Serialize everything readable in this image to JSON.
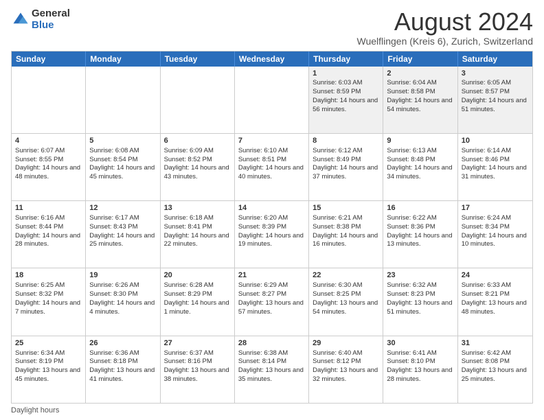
{
  "logo": {
    "general": "General",
    "blue": "Blue"
  },
  "title": "August 2024",
  "subtitle": "Wuelflingen (Kreis 6), Zurich, Switzerland",
  "days": [
    "Sunday",
    "Monday",
    "Tuesday",
    "Wednesday",
    "Thursday",
    "Friday",
    "Saturday"
  ],
  "footer": "Daylight hours",
  "weeks": [
    [
      {
        "day": "",
        "sunrise": "",
        "sunset": "",
        "daylight": "",
        "empty": true
      },
      {
        "day": "",
        "sunrise": "",
        "sunset": "",
        "daylight": "",
        "empty": true
      },
      {
        "day": "",
        "sunrise": "",
        "sunset": "",
        "daylight": "",
        "empty": true
      },
      {
        "day": "",
        "sunrise": "",
        "sunset": "",
        "daylight": "",
        "empty": true
      },
      {
        "day": "1",
        "sunrise": "Sunrise: 6:03 AM",
        "sunset": "Sunset: 8:59 PM",
        "daylight": "Daylight: 14 hours and 56 minutes.",
        "empty": false
      },
      {
        "day": "2",
        "sunrise": "Sunrise: 6:04 AM",
        "sunset": "Sunset: 8:58 PM",
        "daylight": "Daylight: 14 hours and 54 minutes.",
        "empty": false
      },
      {
        "day": "3",
        "sunrise": "Sunrise: 6:05 AM",
        "sunset": "Sunset: 8:57 PM",
        "daylight": "Daylight: 14 hours and 51 minutes.",
        "empty": false
      }
    ],
    [
      {
        "day": "4",
        "sunrise": "Sunrise: 6:07 AM",
        "sunset": "Sunset: 8:55 PM",
        "daylight": "Daylight: 14 hours and 48 minutes.",
        "empty": false
      },
      {
        "day": "5",
        "sunrise": "Sunrise: 6:08 AM",
        "sunset": "Sunset: 8:54 PM",
        "daylight": "Daylight: 14 hours and 45 minutes.",
        "empty": false
      },
      {
        "day": "6",
        "sunrise": "Sunrise: 6:09 AM",
        "sunset": "Sunset: 8:52 PM",
        "daylight": "Daylight: 14 hours and 43 minutes.",
        "empty": false
      },
      {
        "day": "7",
        "sunrise": "Sunrise: 6:10 AM",
        "sunset": "Sunset: 8:51 PM",
        "daylight": "Daylight: 14 hours and 40 minutes.",
        "empty": false
      },
      {
        "day": "8",
        "sunrise": "Sunrise: 6:12 AM",
        "sunset": "Sunset: 8:49 PM",
        "daylight": "Daylight: 14 hours and 37 minutes.",
        "empty": false
      },
      {
        "day": "9",
        "sunrise": "Sunrise: 6:13 AM",
        "sunset": "Sunset: 8:48 PM",
        "daylight": "Daylight: 14 hours and 34 minutes.",
        "empty": false
      },
      {
        "day": "10",
        "sunrise": "Sunrise: 6:14 AM",
        "sunset": "Sunset: 8:46 PM",
        "daylight": "Daylight: 14 hours and 31 minutes.",
        "empty": false
      }
    ],
    [
      {
        "day": "11",
        "sunrise": "Sunrise: 6:16 AM",
        "sunset": "Sunset: 8:44 PM",
        "daylight": "Daylight: 14 hours and 28 minutes.",
        "empty": false
      },
      {
        "day": "12",
        "sunrise": "Sunrise: 6:17 AM",
        "sunset": "Sunset: 8:43 PM",
        "daylight": "Daylight: 14 hours and 25 minutes.",
        "empty": false
      },
      {
        "day": "13",
        "sunrise": "Sunrise: 6:18 AM",
        "sunset": "Sunset: 8:41 PM",
        "daylight": "Daylight: 14 hours and 22 minutes.",
        "empty": false
      },
      {
        "day": "14",
        "sunrise": "Sunrise: 6:20 AM",
        "sunset": "Sunset: 8:39 PM",
        "daylight": "Daylight: 14 hours and 19 minutes.",
        "empty": false
      },
      {
        "day": "15",
        "sunrise": "Sunrise: 6:21 AM",
        "sunset": "Sunset: 8:38 PM",
        "daylight": "Daylight: 14 hours and 16 minutes.",
        "empty": false
      },
      {
        "day": "16",
        "sunrise": "Sunrise: 6:22 AM",
        "sunset": "Sunset: 8:36 PM",
        "daylight": "Daylight: 14 hours and 13 minutes.",
        "empty": false
      },
      {
        "day": "17",
        "sunrise": "Sunrise: 6:24 AM",
        "sunset": "Sunset: 8:34 PM",
        "daylight": "Daylight: 14 hours and 10 minutes.",
        "empty": false
      }
    ],
    [
      {
        "day": "18",
        "sunrise": "Sunrise: 6:25 AM",
        "sunset": "Sunset: 8:32 PM",
        "daylight": "Daylight: 14 hours and 7 minutes.",
        "empty": false
      },
      {
        "day": "19",
        "sunrise": "Sunrise: 6:26 AM",
        "sunset": "Sunset: 8:30 PM",
        "daylight": "Daylight: 14 hours and 4 minutes.",
        "empty": false
      },
      {
        "day": "20",
        "sunrise": "Sunrise: 6:28 AM",
        "sunset": "Sunset: 8:29 PM",
        "daylight": "Daylight: 14 hours and 1 minute.",
        "empty": false
      },
      {
        "day": "21",
        "sunrise": "Sunrise: 6:29 AM",
        "sunset": "Sunset: 8:27 PM",
        "daylight": "Daylight: 13 hours and 57 minutes.",
        "empty": false
      },
      {
        "day": "22",
        "sunrise": "Sunrise: 6:30 AM",
        "sunset": "Sunset: 8:25 PM",
        "daylight": "Daylight: 13 hours and 54 minutes.",
        "empty": false
      },
      {
        "day": "23",
        "sunrise": "Sunrise: 6:32 AM",
        "sunset": "Sunset: 8:23 PM",
        "daylight": "Daylight: 13 hours and 51 minutes.",
        "empty": false
      },
      {
        "day": "24",
        "sunrise": "Sunrise: 6:33 AM",
        "sunset": "Sunset: 8:21 PM",
        "daylight": "Daylight: 13 hours and 48 minutes.",
        "empty": false
      }
    ],
    [
      {
        "day": "25",
        "sunrise": "Sunrise: 6:34 AM",
        "sunset": "Sunset: 8:19 PM",
        "daylight": "Daylight: 13 hours and 45 minutes.",
        "empty": false
      },
      {
        "day": "26",
        "sunrise": "Sunrise: 6:36 AM",
        "sunset": "Sunset: 8:18 PM",
        "daylight": "Daylight: 13 hours and 41 minutes.",
        "empty": false
      },
      {
        "day": "27",
        "sunrise": "Sunrise: 6:37 AM",
        "sunset": "Sunset: 8:16 PM",
        "daylight": "Daylight: 13 hours and 38 minutes.",
        "empty": false
      },
      {
        "day": "28",
        "sunrise": "Sunrise: 6:38 AM",
        "sunset": "Sunset: 8:14 PM",
        "daylight": "Daylight: 13 hours and 35 minutes.",
        "empty": false
      },
      {
        "day": "29",
        "sunrise": "Sunrise: 6:40 AM",
        "sunset": "Sunset: 8:12 PM",
        "daylight": "Daylight: 13 hours and 32 minutes.",
        "empty": false
      },
      {
        "day": "30",
        "sunrise": "Sunrise: 6:41 AM",
        "sunset": "Sunset: 8:10 PM",
        "daylight": "Daylight: 13 hours and 28 minutes.",
        "empty": false
      },
      {
        "day": "31",
        "sunrise": "Sunrise: 6:42 AM",
        "sunset": "Sunset: 8:08 PM",
        "daylight": "Daylight: 13 hours and 25 minutes.",
        "empty": false
      }
    ]
  ]
}
